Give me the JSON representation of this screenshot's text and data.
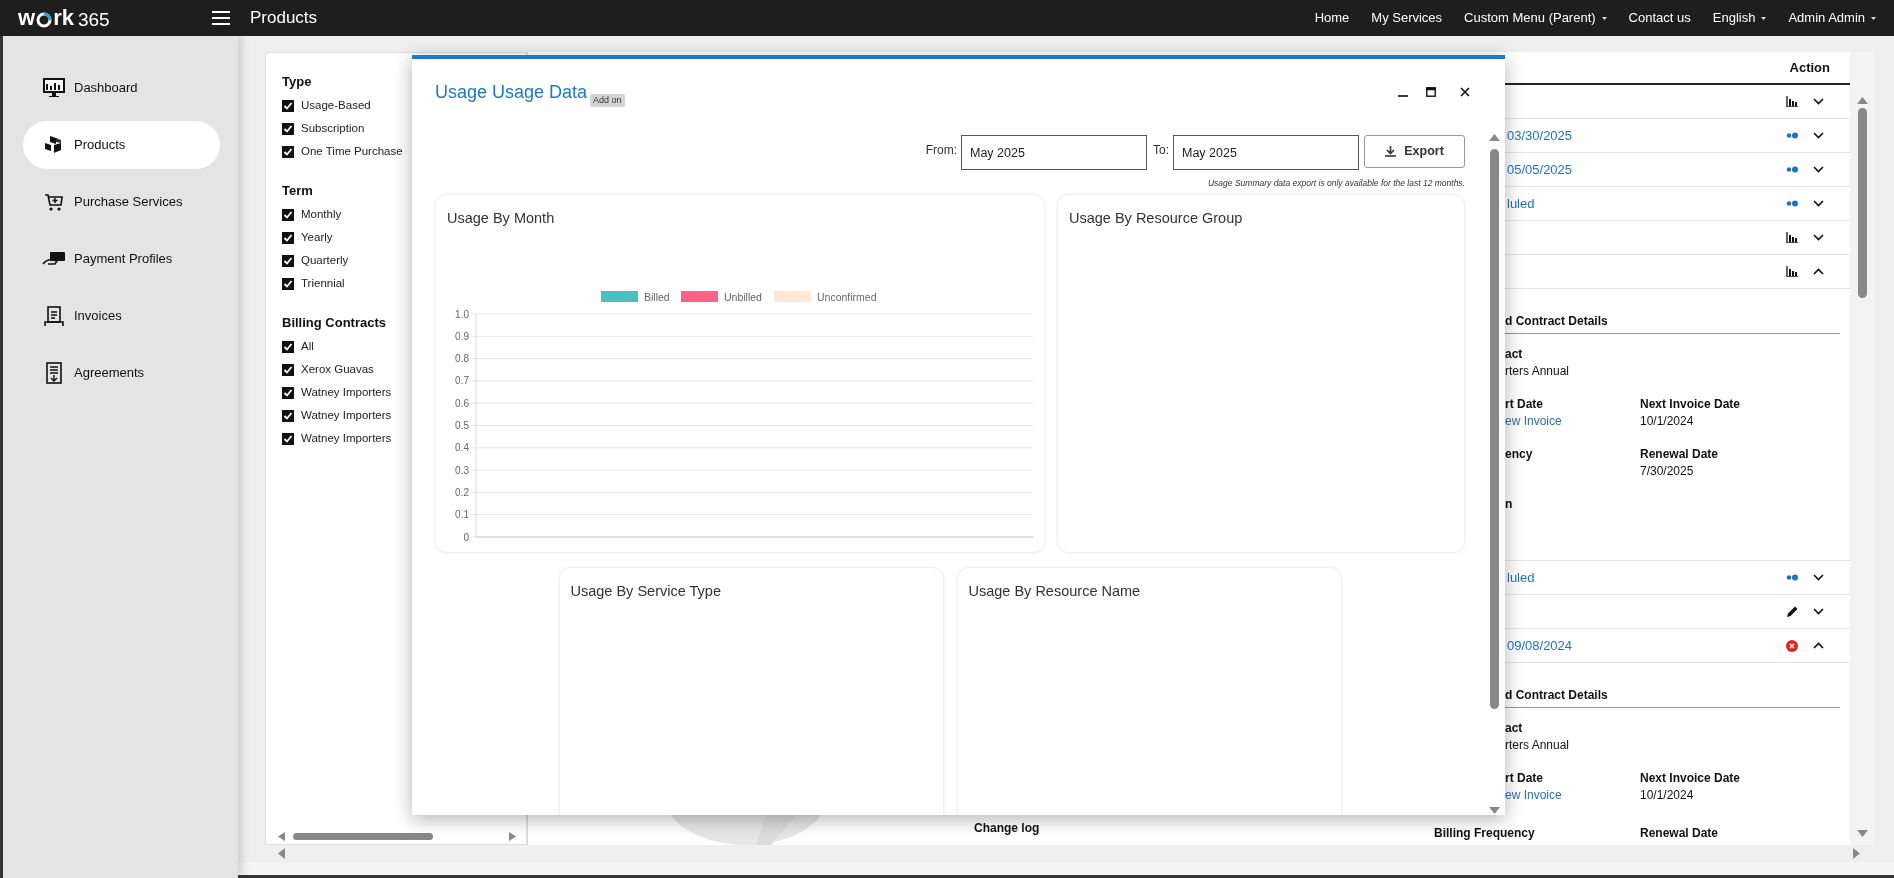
{
  "top_bar": {
    "logo": {
      "before_ring": "w",
      "after_ring": "rk",
      "suffix": "365"
    },
    "page_title": "Products",
    "nav": [
      {
        "label": "Home",
        "dropdown": false
      },
      {
        "label": "My Services",
        "dropdown": false
      },
      {
        "label": "Custom Menu (Parent)",
        "dropdown": true
      },
      {
        "label": "Contact us",
        "dropdown": false
      },
      {
        "label": "English",
        "dropdown": true
      },
      {
        "label": "Admin Admin",
        "dropdown": true
      }
    ]
  },
  "sidebar": {
    "items": [
      {
        "label": "Dashboard",
        "selected": false
      },
      {
        "label": "Products",
        "selected": true
      },
      {
        "label": "Purchase Services",
        "selected": false
      },
      {
        "label": "Payment Profiles",
        "selected": false
      },
      {
        "label": "Invoices",
        "selected": false
      },
      {
        "label": "Agreements",
        "selected": false
      }
    ]
  },
  "filters": {
    "groups": [
      {
        "title": "Type",
        "options": [
          {
            "label": "Usage-Based",
            "checked": true
          },
          {
            "label": "Subscription",
            "checked": true
          },
          {
            "label": "One Time Purchase",
            "checked": true
          }
        ]
      },
      {
        "title": "Term",
        "options": [
          {
            "label": "Monthly",
            "checked": true
          },
          {
            "label": "Yearly",
            "checked": true
          },
          {
            "label": "Quarterly",
            "checked": true
          },
          {
            "label": "Triennial",
            "checked": true
          }
        ]
      },
      {
        "title": "Billing Contracts",
        "options": [
          {
            "label": "All",
            "checked": true
          },
          {
            "label": "Xerox Guavas",
            "checked": true
          },
          {
            "label": "Watney Importers",
            "checked": true
          },
          {
            "label": "Watney Importers",
            "checked": true
          },
          {
            "label": "Watney Importers",
            "checked": true
          }
        ]
      }
    ]
  },
  "middle_panel": {
    "change_log": "Change log"
  },
  "table": {
    "columns": [
      "Action"
    ],
    "rows": [
      {
        "kind": "chart",
        "expanded": false
      },
      {
        "kind": "dots",
        "text": "03/30/2025",
        "expanded": false
      },
      {
        "kind": "dots",
        "text": "05/05/2025",
        "expanded": false
      },
      {
        "kind": "dots",
        "text": "luled",
        "expanded": false
      },
      {
        "kind": "chart",
        "expanded": false
      },
      {
        "kind": "chart",
        "expanded": true
      },
      {
        "kind": "details",
        "heading": "d Contract Details",
        "fields": [
          [
            {
              "label": "act",
              "value": "rters Annual"
            }
          ],
          [
            {
              "label": "rt Date",
              "value": "ew Invoice",
              "link": true
            },
            {
              "label": "Next Invoice Date",
              "value": "10/1/2024"
            }
          ],
          [
            {
              "label": "ency"
            },
            {
              "label": "Renewal Date",
              "value": "7/30/2025"
            }
          ],
          [
            {
              "label": "n"
            }
          ]
        ]
      },
      {
        "kind": "dots",
        "text": "luled",
        "expanded": false
      },
      {
        "kind": "pencil",
        "expanded": false
      },
      {
        "kind": "error",
        "text": "09/08/2024",
        "expanded": true
      },
      {
        "kind": "details",
        "heading": "d Contract Details",
        "fields": [
          [
            {
              "label": "act",
              "value": "rters Annual"
            }
          ],
          [
            {
              "label": "rt Date",
              "value": "ew Invoice",
              "link": true
            },
            {
              "label": "Next Invoice Date",
              "value": "10/1/2024"
            }
          ]
        ],
        "lower_fields": [
          {
            "label": "Billing Frequency"
          },
          {
            "label": "Renewal Date"
          }
        ]
      }
    ]
  },
  "modal": {
    "title": "Usage Usage Data",
    "badge": "Add on",
    "from": {
      "label": "From:",
      "value": "May 2025"
    },
    "to": {
      "label": "To:",
      "value": "May 2025"
    },
    "export_button": "Export",
    "note": "Usage Summary data export is only available for the last 12 months.",
    "cards": [
      {
        "title": "Usage By Month",
        "chart_data": {
          "type": "bar",
          "grid": true,
          "ylim": [
            0,
            1
          ],
          "yticks": [
            {
              "value": 1,
              "label": "1.0"
            },
            0.9,
            0.8,
            0.7,
            0.6,
            0.5,
            0.4,
            0.3,
            0.2,
            0.1,
            0
          ],
          "series": [
            {
              "name": "Billed",
              "color": "#4bc0c0"
            },
            {
              "name": "Unbilled",
              "color": "#ff6384"
            },
            {
              "name": "Unconfirmed",
              "color": "#ffe9d6"
            }
          ]
        }
      },
      {
        "title": "Usage By Resource Group"
      },
      {
        "title": "Usage By Service Type"
      },
      {
        "title": "Usage By Resource Name"
      }
    ]
  }
}
